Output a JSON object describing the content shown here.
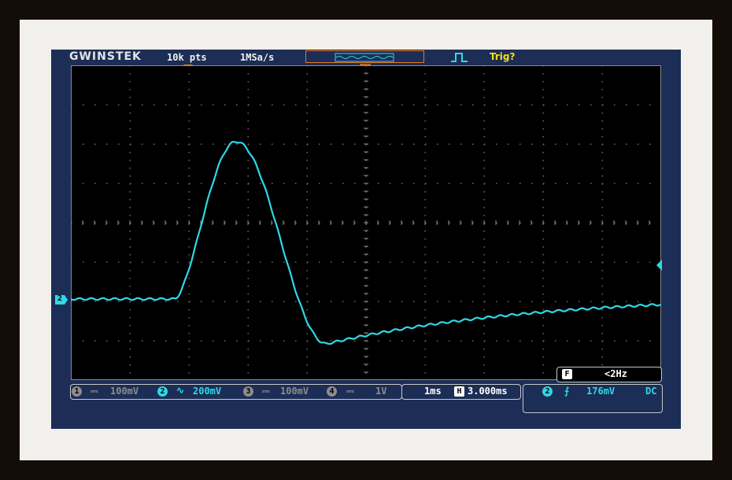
{
  "header": {
    "brand": "GWINSTEK",
    "record_length": "10k pts",
    "sample_rate": "1MSa/s",
    "trigger_status": "Trig?"
  },
  "channels": [
    {
      "number": "1",
      "coupling_icon": "dc-coupling-icon",
      "scale": "100mV",
      "active": false
    },
    {
      "number": "2",
      "coupling_icon": "ac-coupling-icon",
      "scale": "200mV",
      "active": true
    },
    {
      "number": "3",
      "coupling_icon": "dc-coupling-icon",
      "scale": "100mV",
      "active": false
    },
    {
      "number": "4",
      "coupling_icon": "dc-coupling-icon",
      "scale": "1V",
      "active": false
    }
  ],
  "timebase": {
    "scale": "1ms",
    "horizontal_badge": "H",
    "position": "3.000ms"
  },
  "trigger": {
    "source": "2",
    "slope_icon": "rising-edge-icon",
    "level": "176mV",
    "coupling": "DC",
    "frequency_badge": "F",
    "frequency": "<2Hz"
  },
  "channel_marker_label": "2",
  "colors": {
    "trace": "#2fd8e6",
    "accent_orange": "#e8791c",
    "trigger_yellow": "#f4e019",
    "screen_bezel": "#1c2d56"
  }
}
